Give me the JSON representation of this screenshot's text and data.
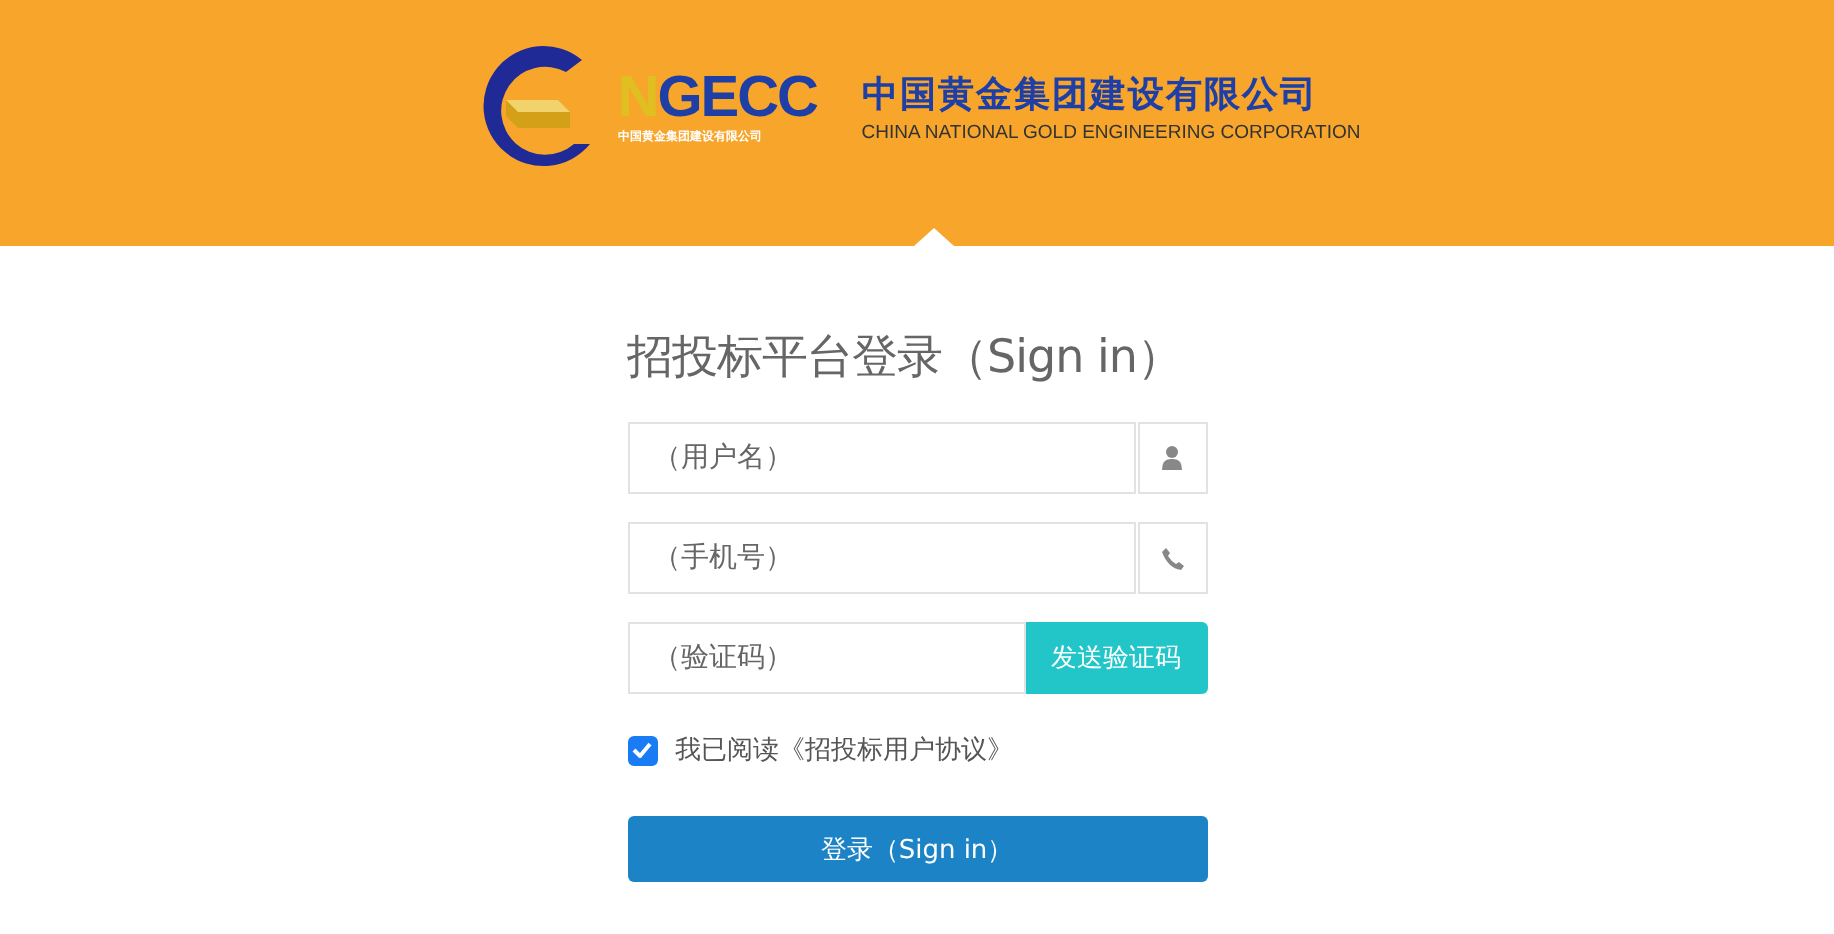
{
  "header": {
    "logo_mark": "NGECC",
    "logo_mark_subtitle": "中国黄金集团建设有限公司",
    "company_name_cn": "中国黄金集团建设有限公司",
    "company_name_en": "CHINA NATIONAL GOLD ENGINEERING CORPORATION"
  },
  "title": "招投标平台登录（Sign in）",
  "fields": [
    {
      "kind": "user",
      "placeholder": "（用户名）"
    },
    {
      "kind": "phone",
      "placeholder": "（手机号）"
    },
    {
      "kind": "button",
      "placeholder": "（验证码）",
      "button": "发送验证码"
    }
  ],
  "agreement": {
    "checked": true,
    "label": "我已阅读《招投标用户协议》"
  },
  "submit": "登录（Sign in）"
}
